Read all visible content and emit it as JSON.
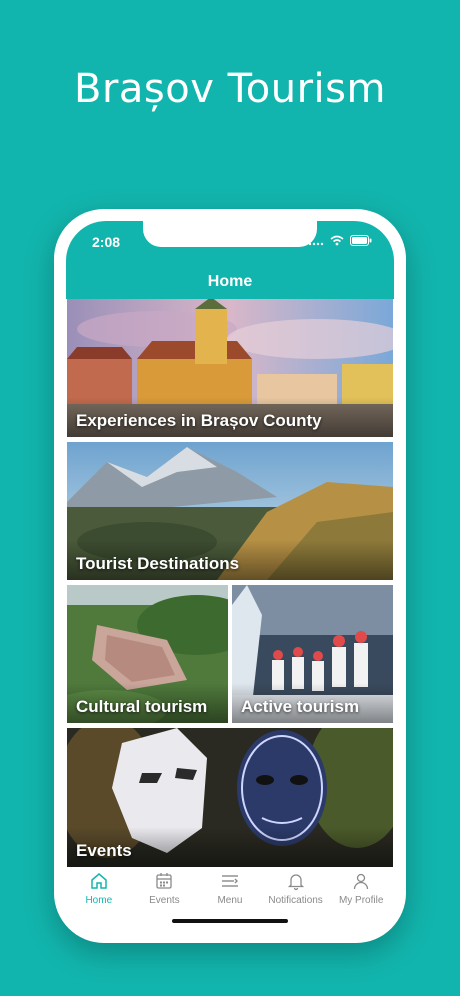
{
  "promo": {
    "title": "Brașov Tourism"
  },
  "status_bar": {
    "time": "2:08",
    "icons": [
      "signal-icon",
      "wifi-icon",
      "battery-icon"
    ]
  },
  "header": {
    "title": "Home"
  },
  "tiles": [
    {
      "label": "Experiences in Brașov County"
    },
    {
      "label": "Tourist Destinations"
    },
    {
      "label": "Cultural tourism"
    },
    {
      "label": "Active tourism"
    },
    {
      "label": "Events"
    }
  ],
  "tabbar": {
    "items": [
      {
        "label": "Home",
        "icon": "home-icon",
        "active": true
      },
      {
        "label": "Events",
        "icon": "calendar-icon",
        "active": false
      },
      {
        "label": "Menu",
        "icon": "menu-icon",
        "active": false
      },
      {
        "label": "Notifications",
        "icon": "bell-icon",
        "active": false
      },
      {
        "label": "My Profile",
        "icon": "profile-icon",
        "active": false
      }
    ]
  },
  "colors": {
    "brand": "#12b5ad",
    "inactive": "#8a8a8a"
  }
}
